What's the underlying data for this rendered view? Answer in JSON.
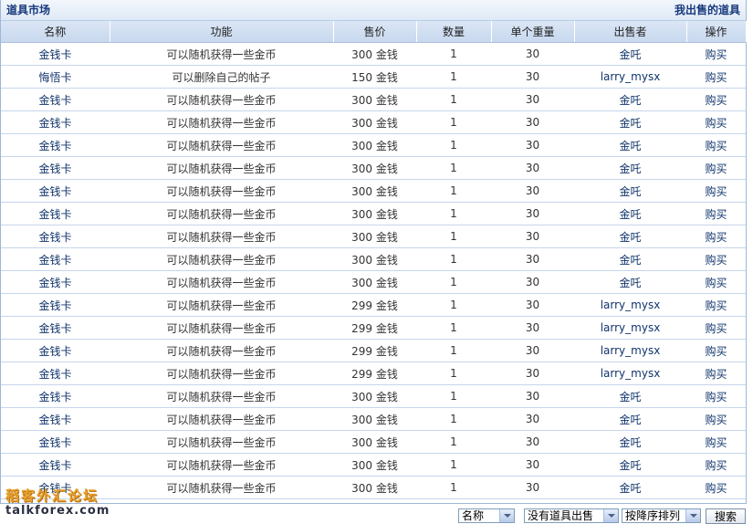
{
  "header": {
    "title": "道具市场",
    "my_sale_link": "我出售的道具"
  },
  "table": {
    "columns": [
      "名称",
      "功能",
      "售价",
      "数量",
      "单个重量",
      "出售者",
      "操作"
    ],
    "rows": [
      {
        "name": "金钱卡",
        "function": "可以随机获得一些金币",
        "price": "300 金钱",
        "qty": "1",
        "weight": "30",
        "seller": "金吒",
        "action": "购买"
      },
      {
        "name": "悔悟卡",
        "function": "可以删除自己的帖子",
        "price": "150 金钱",
        "qty": "1",
        "weight": "30",
        "seller": "larry_mysx",
        "action": "购买"
      },
      {
        "name": "金钱卡",
        "function": "可以随机获得一些金币",
        "price": "300 金钱",
        "qty": "1",
        "weight": "30",
        "seller": "金吒",
        "action": "购买"
      },
      {
        "name": "金钱卡",
        "function": "可以随机获得一些金币",
        "price": "300 金钱",
        "qty": "1",
        "weight": "30",
        "seller": "金吒",
        "action": "购买"
      },
      {
        "name": "金钱卡",
        "function": "可以随机获得一些金币",
        "price": "300 金钱",
        "qty": "1",
        "weight": "30",
        "seller": "金吒",
        "action": "购买"
      },
      {
        "name": "金钱卡",
        "function": "可以随机获得一些金币",
        "price": "300 金钱",
        "qty": "1",
        "weight": "30",
        "seller": "金吒",
        "action": "购买"
      },
      {
        "name": "金钱卡",
        "function": "可以随机获得一些金币",
        "price": "300 金钱",
        "qty": "1",
        "weight": "30",
        "seller": "金吒",
        "action": "购买"
      },
      {
        "name": "金钱卡",
        "function": "可以随机获得一些金币",
        "price": "300 金钱",
        "qty": "1",
        "weight": "30",
        "seller": "金吒",
        "action": "购买"
      },
      {
        "name": "金钱卡",
        "function": "可以随机获得一些金币",
        "price": "300 金钱",
        "qty": "1",
        "weight": "30",
        "seller": "金吒",
        "action": "购买"
      },
      {
        "name": "金钱卡",
        "function": "可以随机获得一些金币",
        "price": "300 金钱",
        "qty": "1",
        "weight": "30",
        "seller": "金吒",
        "action": "购买"
      },
      {
        "name": "金钱卡",
        "function": "可以随机获得一些金币",
        "price": "300 金钱",
        "qty": "1",
        "weight": "30",
        "seller": "金吒",
        "action": "购买"
      },
      {
        "name": "金钱卡",
        "function": "可以随机获得一些金币",
        "price": "299 金钱",
        "qty": "1",
        "weight": "30",
        "seller": "larry_mysx",
        "action": "购买"
      },
      {
        "name": "金钱卡",
        "function": "可以随机获得一些金币",
        "price": "299 金钱",
        "qty": "1",
        "weight": "30",
        "seller": "larry_mysx",
        "action": "购买"
      },
      {
        "name": "金钱卡",
        "function": "可以随机获得一些金币",
        "price": "299 金钱",
        "qty": "1",
        "weight": "30",
        "seller": "larry_mysx",
        "action": "购买"
      },
      {
        "name": "金钱卡",
        "function": "可以随机获得一些金币",
        "price": "299 金钱",
        "qty": "1",
        "weight": "30",
        "seller": "larry_mysx",
        "action": "购买"
      },
      {
        "name": "金钱卡",
        "function": "可以随机获得一些金币",
        "price": "300 金钱",
        "qty": "1",
        "weight": "30",
        "seller": "金吒",
        "action": "购买"
      },
      {
        "name": "金钱卡",
        "function": "可以随机获得一些金币",
        "price": "300 金钱",
        "qty": "1",
        "weight": "30",
        "seller": "金吒",
        "action": "购买"
      },
      {
        "name": "金钱卡",
        "function": "可以随机获得一些金币",
        "price": "300 金钱",
        "qty": "1",
        "weight": "30",
        "seller": "金吒",
        "action": "购买"
      },
      {
        "name": "金钱卡",
        "function": "可以随机获得一些金币",
        "price": "300 金钱",
        "qty": "1",
        "weight": "30",
        "seller": "金吒",
        "action": "购买"
      },
      {
        "name": "金钱卡",
        "function": "可以随机获得一些金币",
        "price": "300 金钱",
        "qty": "1",
        "weight": "30",
        "seller": "金吒",
        "action": "购买"
      }
    ]
  },
  "filters": {
    "sort_field": "名称",
    "sale_filter": "没有道具出售",
    "sort_order": "按降序排列",
    "search_label": "搜索"
  },
  "watermark": {
    "cn": "稻客外汇论坛",
    "en": "talkforex.com"
  },
  "colors": {
    "link": "#10346b",
    "header_bg": "#c8d8ee",
    "row_border": "#c6d6ec"
  }
}
